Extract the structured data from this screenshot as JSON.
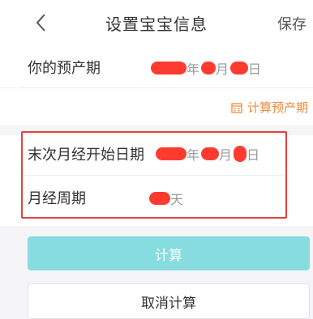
{
  "header": {
    "back_icon": "chevron-left-icon",
    "title": "设置宝宝信息",
    "save_label": "保存"
  },
  "due_date": {
    "label": "你的预产期",
    "year_unit": "年",
    "month_unit": "月",
    "day_unit": "日"
  },
  "calc_due_link": {
    "icon": "calendar-icon",
    "label": "计算预产期"
  },
  "last_period": {
    "label": "末次月经开始日期",
    "year_unit": "年",
    "month_unit": "月",
    "day_unit": "日"
  },
  "cycle": {
    "label": "月经周期",
    "unit": "天"
  },
  "buttons": {
    "calculate": "计算",
    "cancel": "取消计算"
  },
  "colors": {
    "accent_orange": "#f08a3c",
    "button_teal": "#86dcdf",
    "highlight_red": "#e0433a",
    "redaction_red": "#ff3b30"
  }
}
